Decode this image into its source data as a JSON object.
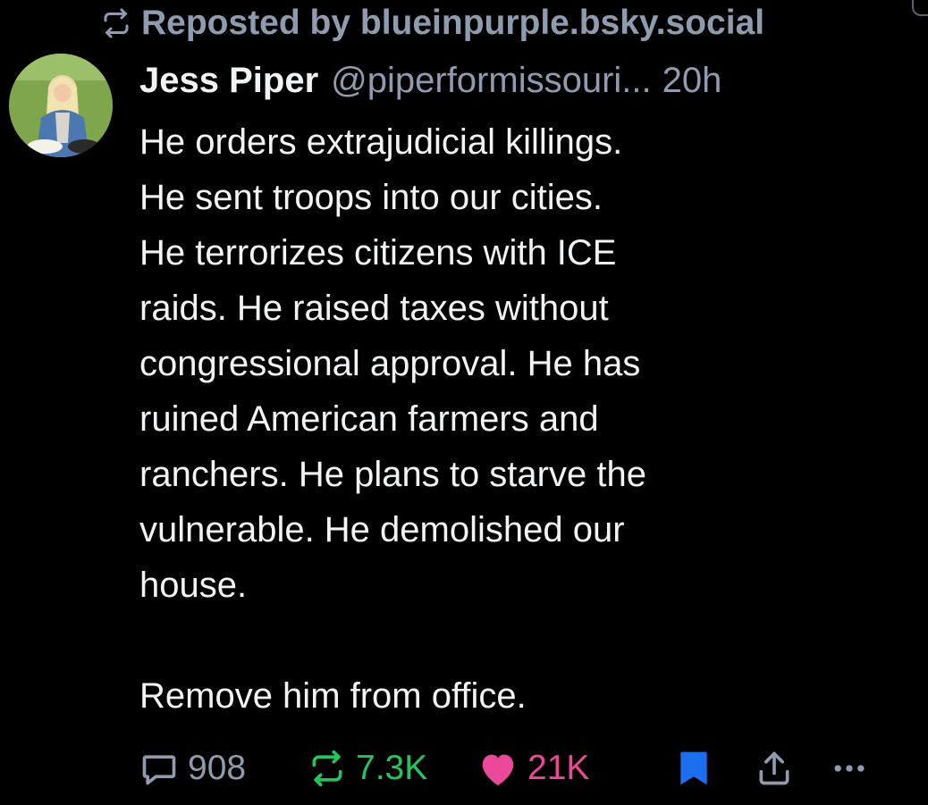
{
  "repost": {
    "label": "Reposted by blueinpurple.bsky.social",
    "icon": "repost-icon"
  },
  "author": {
    "display_name": "Jess Piper",
    "handle": "@piperformissouri...",
    "time": "20h",
    "avatar": "avatar-photo"
  },
  "post": {
    "lines": [
      "He orders extrajudicial killings.",
      "He sent troops into our cities.",
      "He terrorizes citizens with ICE",
      "raids. He raised taxes without",
      "congressional approval. He has",
      "ruined American farmers and",
      "ranchers. He plans to starve the",
      "vulnerable. He demolished our",
      "house.",
      "",
      "Remove him from office."
    ]
  },
  "actions": {
    "reply_count": "908",
    "repost_count": "7.3K",
    "like_count": "21K"
  },
  "colors": {
    "background": "#000000",
    "text": "#f1f3f5",
    "muted": "#8f9bae",
    "repost_green": "#22c55e",
    "like_pink": "#ec4899",
    "bookmark_blue": "#1d6ff2"
  },
  "icons": [
    "repost-icon",
    "reply-icon",
    "repost-action-icon",
    "heart-icon",
    "bookmark-icon",
    "share-icon",
    "more-icon"
  ]
}
